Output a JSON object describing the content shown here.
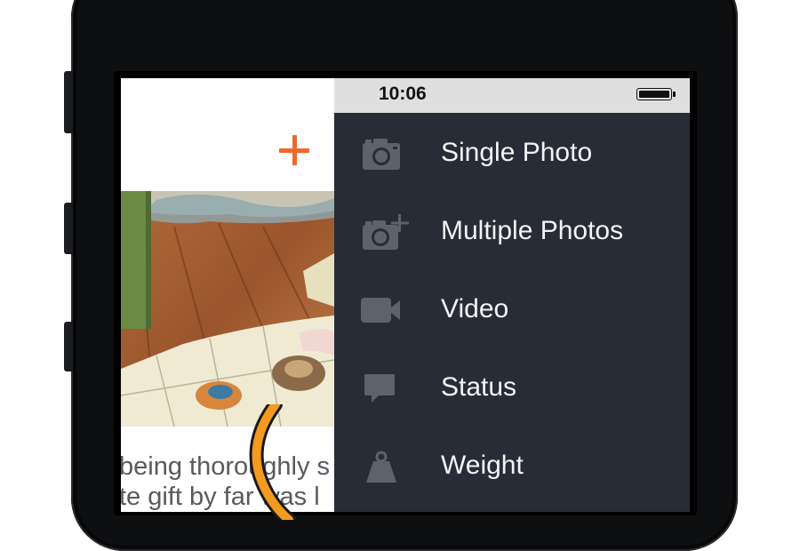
{
  "status_bar": {
    "time": "10:06"
  },
  "header": {
    "add_icon": "plus-icon",
    "accent": "#f0672c"
  },
  "feed": {
    "snippet_lines": [
      "being thoroughly s",
      "te gift by far was l"
    ]
  },
  "menu": {
    "items": [
      {
        "label": "Single Photo",
        "icon": "camera-icon"
      },
      {
        "label": "Multiple Photos",
        "icon": "camera-plus-icon"
      },
      {
        "label": "Video",
        "icon": "video-camera-icon"
      },
      {
        "label": "Status",
        "icon": "speech-bubble-icon"
      },
      {
        "label": "Weight",
        "icon": "weight-icon"
      }
    ],
    "background": "#282c36",
    "icon_color": "#5d626d"
  }
}
